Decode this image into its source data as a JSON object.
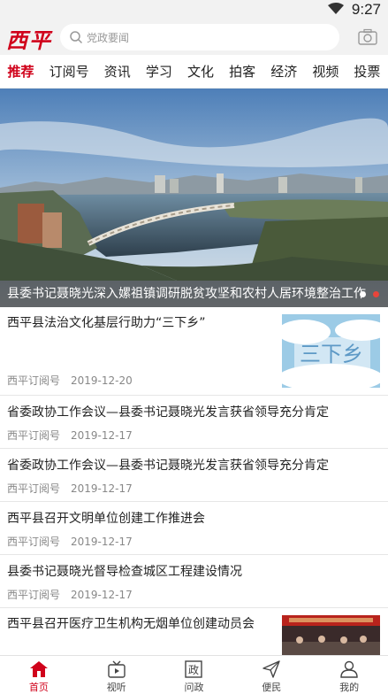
{
  "status_bar": {
    "time": "9:27"
  },
  "header": {
    "logo": "西平",
    "search_placeholder": "党政要闻"
  },
  "tabs": [
    {
      "label": "推荐",
      "active": true
    },
    {
      "label": "订阅号"
    },
    {
      "label": "资讯"
    },
    {
      "label": "学习"
    },
    {
      "label": "文化"
    },
    {
      "label": "拍客"
    },
    {
      "label": "经济"
    },
    {
      "label": "视频"
    },
    {
      "label": "投票"
    }
  ],
  "banner": {
    "caption": "县委书记聂晓光深入嫘祖镇调研脱贫攻坚和农村人居环境整治工作",
    "slide_count": 2,
    "active_slide": 2
  },
  "news": [
    {
      "title": "西平县法治文化基层行助力“三下乡”",
      "source": "西平订阅号",
      "date": "2019-12-20",
      "thumb_text": "三下乡"
    },
    {
      "title": "省委政协工作会议—县委书记聂晓光发言获省领导充分肯定",
      "source": "西平订阅号",
      "date": "2019-12-17"
    },
    {
      "title": "省委政协工作会议—县委书记聂晓光发言获省领导充分肯定",
      "source": "西平订阅号",
      "date": "2019-12-17"
    },
    {
      "title": "西平县召开文明单位创建工作推进会",
      "source": "西平订阅号",
      "date": "2019-12-17"
    },
    {
      "title": "县委书记聂晓光督导检查城区工程建设情况",
      "source": "西平订阅号",
      "date": "2019-12-17"
    },
    {
      "title": "西平县召开医疗卫生机构无烟单位创建动员会"
    }
  ],
  "bottom_nav": [
    {
      "label": "首页",
      "icon": "home-icon",
      "active": true
    },
    {
      "label": "视听",
      "icon": "tv-icon"
    },
    {
      "label": "问政",
      "icon": "zheng-icon",
      "glyph": "政"
    },
    {
      "label": "便民",
      "icon": "send-icon"
    },
    {
      "label": "我的",
      "icon": "user-icon"
    }
  ],
  "colors": {
    "accent": "#d0021b",
    "header_bg": "#f2f2f2"
  }
}
